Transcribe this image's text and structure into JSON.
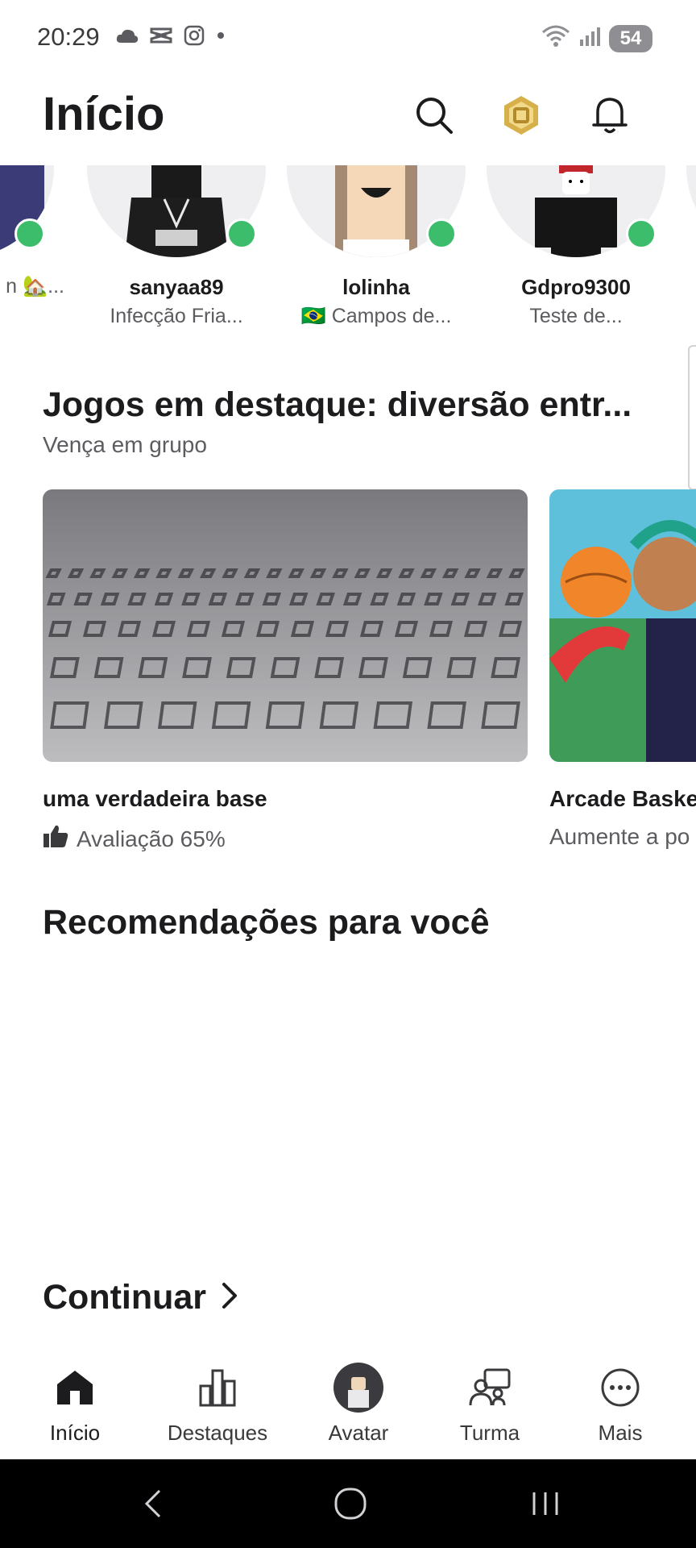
{
  "status_bar": {
    "time": "20:29",
    "battery": "54",
    "icons_left": [
      "cloud-icon",
      "capcut-icon",
      "instagram-icon",
      "dot-icon"
    ],
    "icons_right": [
      "wifi-icon",
      "signal-icon",
      "battery-icon"
    ]
  },
  "header": {
    "title": "Início",
    "icons": [
      "search-icon",
      "robux-icon",
      "bell-icon"
    ]
  },
  "friends": [
    {
      "name": "",
      "status": "n 🏡..."
    },
    {
      "name": "sanyaa89",
      "status": "Infecção Fria..."
    },
    {
      "name": "lolinha",
      "status": "Campos de...",
      "flag": "🇧🇷"
    },
    {
      "name": "Gdpro9300",
      "status": "Teste de..."
    }
  ],
  "featured": {
    "title": "Jogos em destaque: diversão entr...",
    "subtitle": "Vença em grupo",
    "games": [
      {
        "title": "uma verdadeira base",
        "rating": "Avaliação 65%"
      },
      {
        "title": "Arcade Baske",
        "subtitle": "Aumente a po"
      }
    ]
  },
  "recommendations": {
    "title": "Recomendações para você"
  },
  "continue": {
    "label": "Continuar"
  },
  "bottom_nav": [
    {
      "label": "Início",
      "icon": "home-icon"
    },
    {
      "label": "Destaques",
      "icon": "chart-icon"
    },
    {
      "label": "Avatar",
      "icon": "avatar-icon"
    },
    {
      "label": "Turma",
      "icon": "group-icon"
    },
    {
      "label": "Mais",
      "icon": "more-icon"
    }
  ],
  "colors": {
    "online": "#3bbd6b",
    "robux": "#d8b04a",
    "text_primary": "#1c1c1e",
    "text_secondary": "#5c5c60"
  }
}
